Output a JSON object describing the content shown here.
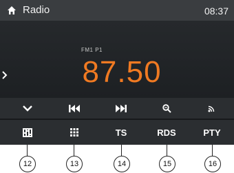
{
  "status_bar": {
    "title": "Radio",
    "time": "08:37"
  },
  "tuner": {
    "band_label": "FM1  P1",
    "frequency": "87.50"
  },
  "controls": [
    {
      "icon": "chevron-down-icon"
    },
    {
      "icon": "seek-back-icon"
    },
    {
      "icon": "seek-forward-icon"
    },
    {
      "icon": "search-icon"
    },
    {
      "icon": "broadcast-icon"
    }
  ],
  "functions": [
    {
      "icon": "equalizer-icon"
    },
    {
      "icon": "grid-icon"
    },
    {
      "label": "TS"
    },
    {
      "label": "RDS"
    },
    {
      "label": "PTY"
    }
  ],
  "callouts": [
    "12",
    "13",
    "14",
    "15",
    "16"
  ],
  "colors": {
    "accent": "#f07a22",
    "background": "#1f2326",
    "bar": "#3a3d40"
  }
}
